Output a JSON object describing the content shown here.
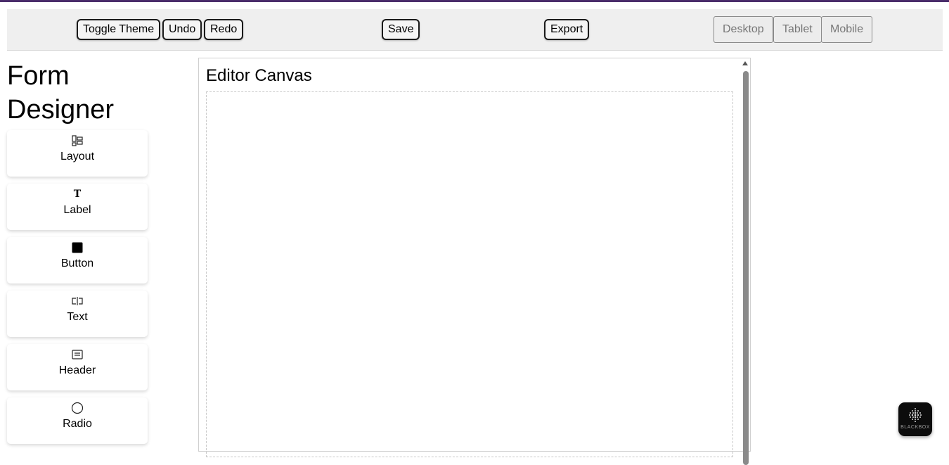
{
  "toolbar": {
    "toggle_theme_label": "Toggle Theme",
    "undo_label": "Undo",
    "redo_label": "Redo",
    "save_label": "Save",
    "export_label": "Export",
    "view_modes": [
      "Desktop",
      "Tablet",
      "Mobile"
    ]
  },
  "sidebar": {
    "title_line1": "Form",
    "title_line2": "Designer",
    "items": [
      {
        "label": "Layout",
        "icon": "layout-icon"
      },
      {
        "label": "Label",
        "icon": "text-t-icon"
      },
      {
        "label": "Button",
        "icon": "filled-square-icon"
      },
      {
        "label": "Text",
        "icon": "text-input-icon"
      },
      {
        "label": "Header",
        "icon": "header-card-icon"
      },
      {
        "label": "Radio",
        "icon": "radio-circle-icon"
      }
    ]
  },
  "canvas": {
    "title": "Editor Canvas"
  },
  "assistant": {
    "label": "BLACKBOX"
  }
}
